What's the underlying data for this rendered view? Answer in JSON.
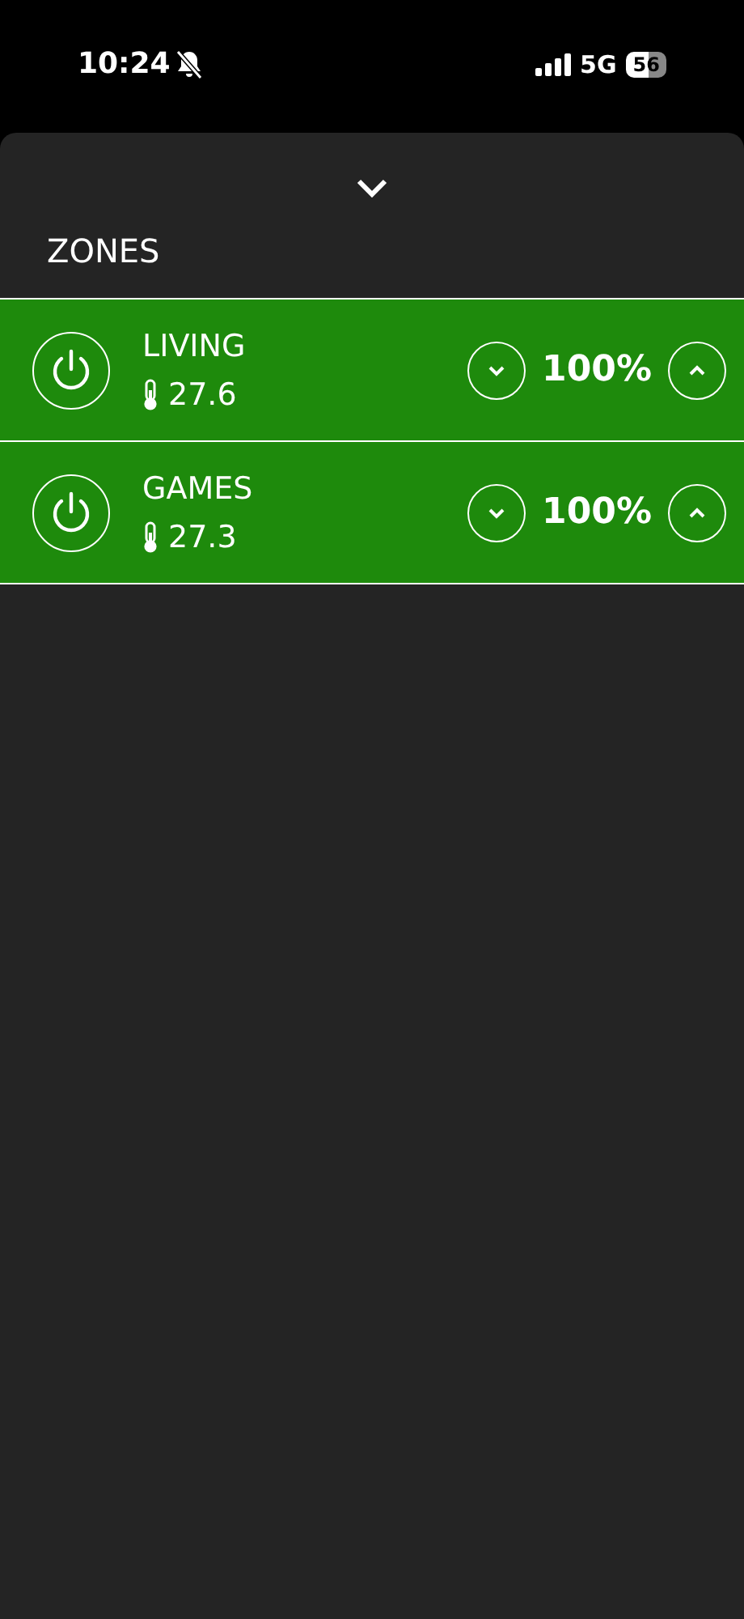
{
  "status_bar": {
    "time": "10:24",
    "network": "5G",
    "battery": "56"
  },
  "sheet": {
    "title": "ZONES"
  },
  "zones": [
    {
      "name": "LIVING",
      "temperature": "27.6",
      "level_text": "100%",
      "on": true
    },
    {
      "name": "GAMES",
      "temperature": "27.3",
      "level_text": "100%",
      "on": true
    }
  ]
}
